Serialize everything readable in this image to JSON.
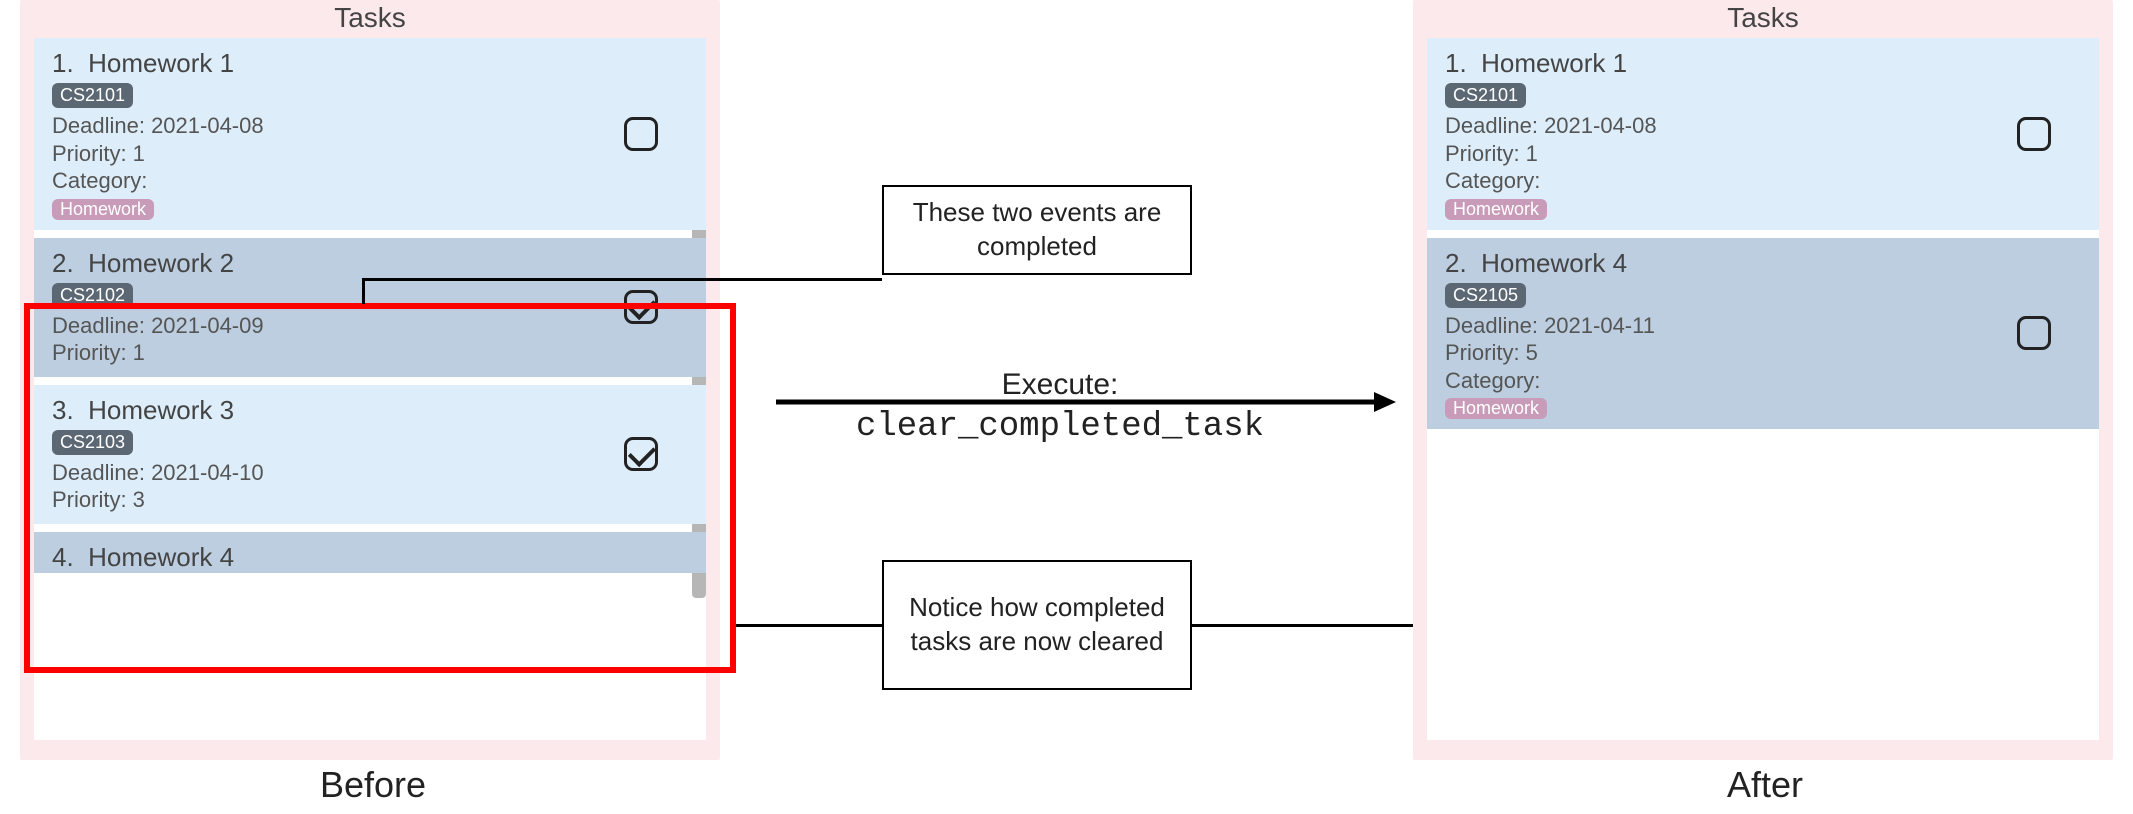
{
  "headers": {
    "before_tasks": "Tasks",
    "after_tasks": "Tasks",
    "before_label": "Before",
    "after_label": "After"
  },
  "annotations": {
    "completed_label": "These two events are completed",
    "cleared_label": "Notice how completed tasks are now cleared",
    "execute_label": "Execute:",
    "execute_cmd": "clear_completed_task"
  },
  "before": {
    "tasks": [
      {
        "idx": "1.",
        "title": "Homework 1",
        "module": "CS2101",
        "deadline_label": "Deadline: 2021-04-08",
        "priority_label": "Priority: 1",
        "category_label": "Category:",
        "category_pill": "Homework",
        "checked": false,
        "show_category": true,
        "shade": "light"
      },
      {
        "idx": "2.",
        "title": "Homework 2",
        "module": "CS2102",
        "deadline_label": "Deadline: 2021-04-09",
        "priority_label": "Priority: 1",
        "category_label": "",
        "category_pill": "",
        "checked": true,
        "show_category": false,
        "shade": "dark"
      },
      {
        "idx": "3.",
        "title": "Homework 3",
        "module": "CS2103",
        "deadline_label": "Deadline: 2021-04-10",
        "priority_label": "Priority: 3",
        "category_label": "",
        "category_pill": "",
        "checked": true,
        "show_category": false,
        "shade": "light"
      },
      {
        "idx": "4.",
        "title": "Homework 4",
        "module": "",
        "deadline_label": "",
        "priority_label": "",
        "category_label": "",
        "category_pill": "",
        "checked": false,
        "show_category": false,
        "shade": "dark",
        "partial": true
      }
    ]
  },
  "after": {
    "tasks": [
      {
        "idx": "1.",
        "title": "Homework 1",
        "module": "CS2101",
        "deadline_label": "Deadline: 2021-04-08",
        "priority_label": "Priority: 1",
        "category_label": "Category:",
        "category_pill": "Homework",
        "checked": false,
        "show_category": true,
        "shade": "light"
      },
      {
        "idx": "2.",
        "title": "Homework 4",
        "module": "CS2105",
        "deadline_label": "Deadline: 2021-04-11",
        "priority_label": "Priority: 5",
        "category_label": "Category:",
        "category_pill": "Homework",
        "checked": false,
        "show_category": true,
        "shade": "dark"
      }
    ]
  }
}
